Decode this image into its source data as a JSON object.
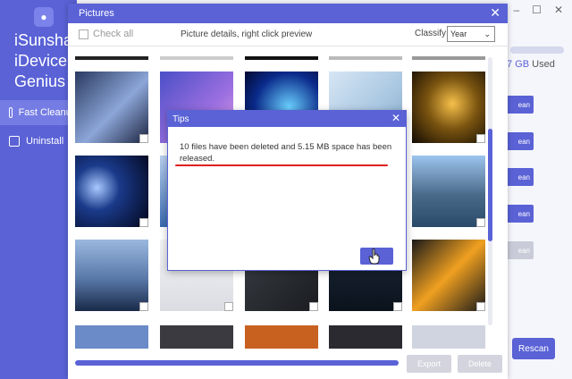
{
  "app": {
    "name": "iSunshare\niDevice\nGenius",
    "sidebar": [
      {
        "label": "Fast Cleanup",
        "active": true
      },
      {
        "label": "Uninstall",
        "active": false
      }
    ],
    "titlebar": {
      "min": "–",
      "max": "☐",
      "close": "✕"
    },
    "storage": {
      "used_num": "7 GB",
      "used_label": "Used"
    },
    "clean_buttons": [
      "ean",
      "ean",
      "ean",
      "ean",
      "ean",
      "ean"
    ],
    "rescan": "Rescan"
  },
  "pictures": {
    "title": "Pictures",
    "check_all": "Check all",
    "details": "Picture details, right click preview",
    "classify_label": "Classify:",
    "classify_value": "Year",
    "export": "Export",
    "delete": "Delete"
  },
  "tips": {
    "title": "Tips",
    "message": "10 files have been deleted and 5.15 MB space has been released."
  },
  "icons": {
    "apple": "apple-logo",
    "cursor": "hand-cursor"
  }
}
